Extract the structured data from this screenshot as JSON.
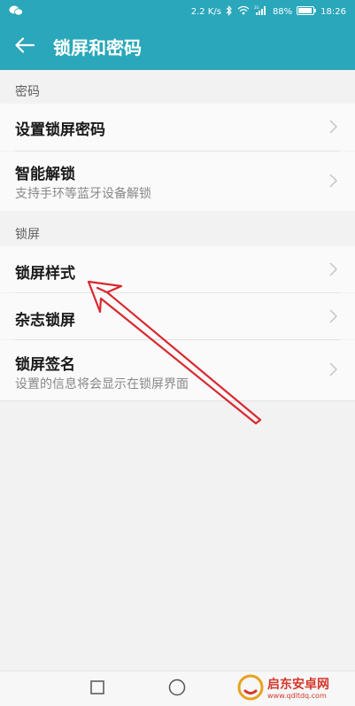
{
  "status_bar": {
    "speed": "2.2 K/s",
    "battery": "88%",
    "time": "18:26",
    "signal_label": "2G"
  },
  "header": {
    "title": "锁屏和密码"
  },
  "sections": {
    "password": {
      "header": "密码",
      "items": [
        {
          "title": "设置锁屏密码"
        },
        {
          "title": "智能解锁",
          "subtitle": "支持手环等蓝牙设备解锁"
        }
      ]
    },
    "lockscreen": {
      "header": "锁屏",
      "items": [
        {
          "title": "锁屏样式"
        },
        {
          "title": "杂志锁屏"
        },
        {
          "title": "锁屏签名",
          "subtitle": "设置的信息将会显示在锁屏界面"
        }
      ]
    }
  },
  "watermark": {
    "title": "启东安卓网",
    "url": "www.qdltdq.com"
  },
  "colors": {
    "accent": "#2aa7ba",
    "annotation_arrow": "#d9282f"
  }
}
